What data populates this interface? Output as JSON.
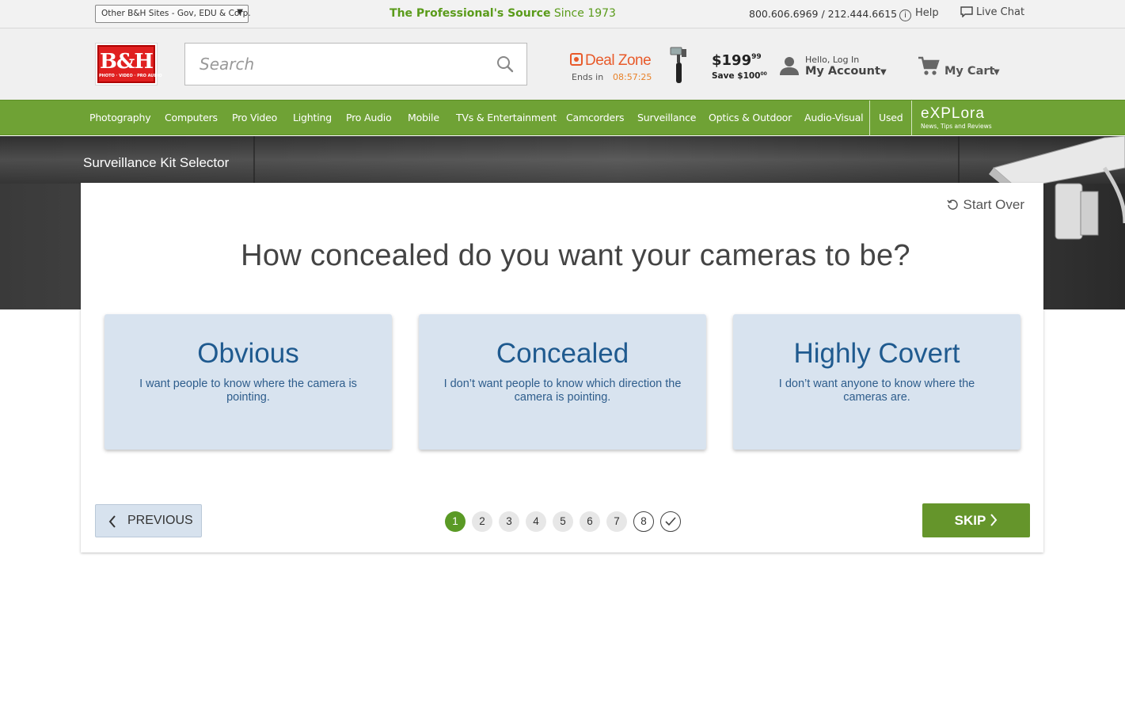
{
  "topbar": {
    "other_sites": "Other B&H Sites - Gov, EDU & Corp.",
    "tagline_main": "The Professional's Source",
    "tagline_since": " Since 1973",
    "phones": "800.606.6969 / 212.444.6615",
    "help": "Help",
    "live_chat": "Live Chat"
  },
  "header": {
    "logo_text": "B&H",
    "logo_sub": "PHOTO · VIDEO · PRO AUDIO",
    "search_placeholder": "Search",
    "deal_zone": {
      "deal": "Deal",
      "zone": "Zone",
      "ends_label": "Ends in",
      "timer": "08:57:25"
    },
    "deal_price": {
      "dollars": "$199",
      "cents": "99",
      "save": "Save $100",
      "save_cents": "00"
    },
    "account": {
      "hello": "Hello, Log In",
      "label": "My Account"
    },
    "cart": {
      "label": "My Cart"
    }
  },
  "nav": {
    "items": [
      "Photography",
      "Computers",
      "Pro Video",
      "Lighting",
      "Pro Audio",
      "Mobile",
      "TVs & Entertainment",
      "Camcorders",
      "Surveillance",
      "Optics & Outdoor",
      "Audio-Visual",
      "Used"
    ],
    "explora": {
      "name": "eXPLora",
      "sub": "News, Tips and Reviews"
    }
  },
  "hero": {
    "title": "Surveillance Kit Selector"
  },
  "selector": {
    "start_over": "Start Over",
    "question": "How concealed do you want your cameras to be?",
    "options": [
      {
        "title": "Obvious",
        "desc": "I want people to know where the camera is pointing."
      },
      {
        "title": "Concealed",
        "desc": "I don’t want people to know which direction the camera is pointing."
      },
      {
        "title": "Highly Covert",
        "desc": "I don’t want anyone to know where the cameras are."
      }
    ],
    "previous": "PREVIOUS",
    "skip": "SKIP",
    "steps": [
      "1",
      "2",
      "3",
      "4",
      "5",
      "6",
      "7",
      "8"
    ],
    "current_step": "1"
  },
  "colors": {
    "nav_green": "#6fa235",
    "tagline_green": "#5a9b1a",
    "option_bg": "#d8e3ef",
    "option_text": "#1f5a8f",
    "skip_green": "#65952b",
    "deal_orange": "#e85a2a"
  }
}
